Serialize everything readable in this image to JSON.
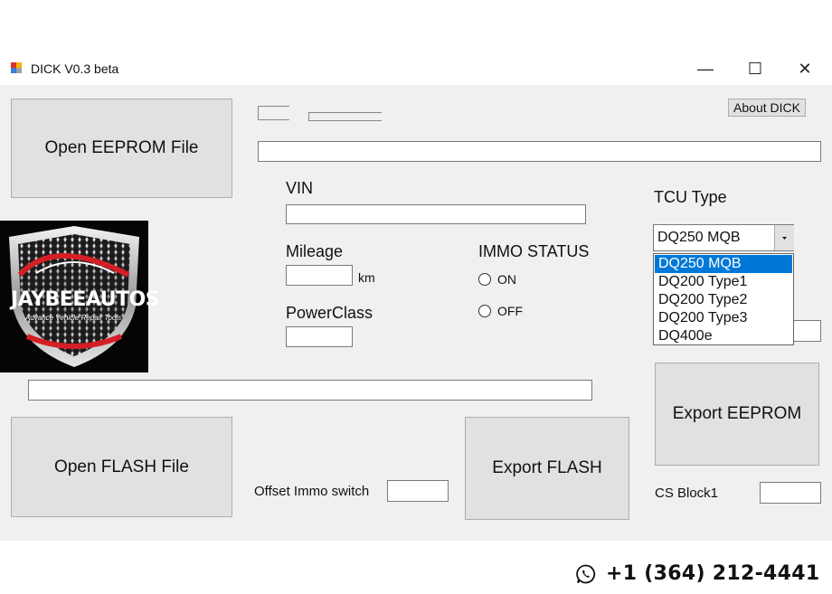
{
  "window": {
    "title": "DICK  V0.3 beta",
    "icon": "app-icon",
    "controls": {
      "minimize": "—",
      "maximize": "☐",
      "close": "✕"
    }
  },
  "buttons": {
    "open_eeprom": "Open EEPROM File",
    "about": "About DICK",
    "open_flash": "Open FLASH File",
    "export_flash": "Export FLASH",
    "export_eeprom": "Export EEPROM"
  },
  "fields": {
    "vin_label": "VIN",
    "vin_value": "",
    "mileage_label": "Mileage",
    "mileage_value": "",
    "mileage_unit": "km",
    "powerclass_label": "PowerClass",
    "powerclass_value": "",
    "offset_label": "Offset Immo switch",
    "offset_value": "",
    "cs_label": "CS Block1",
    "cs_value": ""
  },
  "immo": {
    "label": "IMMO STATUS",
    "on": "ON",
    "off": "OFF"
  },
  "tcu": {
    "label": "TCU Type",
    "selected": "DQ250 MQB",
    "options": [
      "DQ250 MQB",
      "DQ200 Type1",
      "DQ200 Type2",
      "DQ200 Type3",
      "DQ400e"
    ],
    "highlighted_index": 0
  },
  "logo": {
    "brand": "JAYBEEAUTOS",
    "tagline": "Advance Vehicle Repair Tools"
  },
  "footer": {
    "phone_icon": "whatsapp-icon",
    "phone": "+1 (364) 212-4441"
  },
  "colors": {
    "selection": "#0078d7",
    "window_bg": "#f0f0f0",
    "button_bg": "#e1e1e1",
    "logo_red": "#d41f26"
  }
}
